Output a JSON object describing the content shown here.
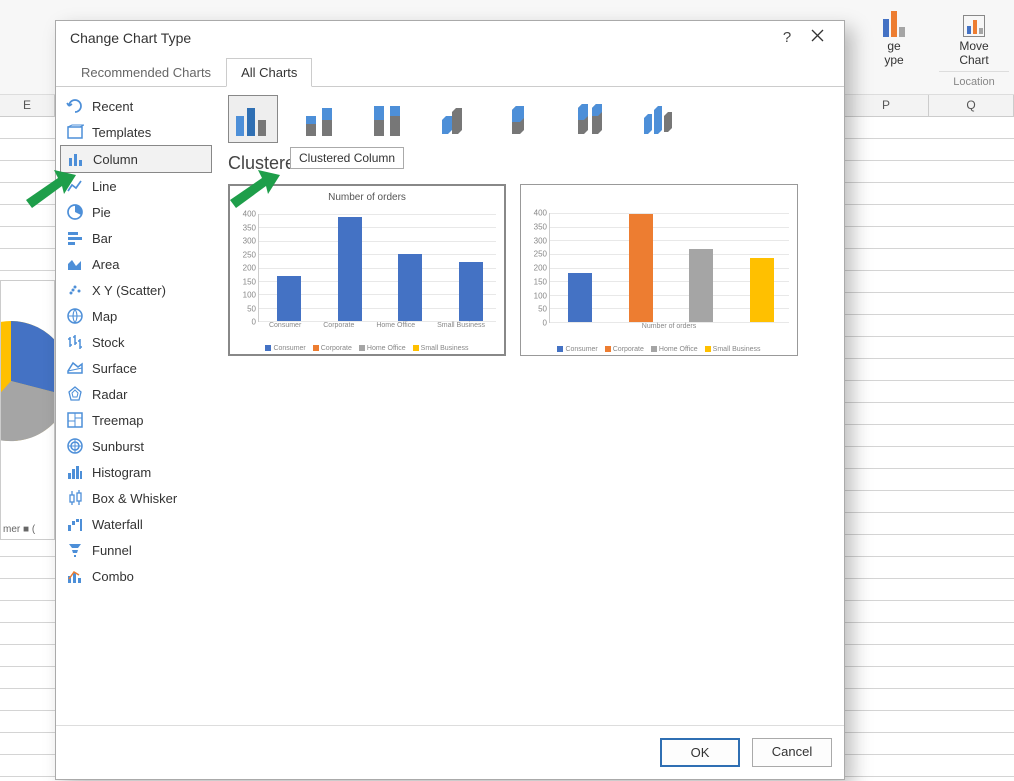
{
  "ribbon": {
    "change_type_btn_l1": "ge",
    "change_type_btn_l2": "ype",
    "move_chart_btn_l1": "Move",
    "move_chart_btn_l2": "Chart",
    "section_location": "Location"
  },
  "bg_columns": {
    "E": "E",
    "P": "P",
    "Q": "Q"
  },
  "bg_legend_frag": "mer   ■ (",
  "dialog": {
    "title": "Change Chart Type",
    "help": "?"
  },
  "tabs": {
    "recommended": "Recommended Charts",
    "all": "All Charts"
  },
  "categories": [
    {
      "label": "Recent",
      "icon": "recent"
    },
    {
      "label": "Templates",
      "icon": "templates"
    },
    {
      "label": "Column",
      "icon": "column",
      "selected": true
    },
    {
      "label": "Line",
      "icon": "line"
    },
    {
      "label": "Pie",
      "icon": "pie"
    },
    {
      "label": "Bar",
      "icon": "bar"
    },
    {
      "label": "Area",
      "icon": "area"
    },
    {
      "label": "X Y (Scatter)",
      "icon": "scatter"
    },
    {
      "label": "Map",
      "icon": "map"
    },
    {
      "label": "Stock",
      "icon": "stock"
    },
    {
      "label": "Surface",
      "icon": "surface"
    },
    {
      "label": "Radar",
      "icon": "radar"
    },
    {
      "label": "Treemap",
      "icon": "treemap"
    },
    {
      "label": "Sunburst",
      "icon": "sunburst"
    },
    {
      "label": "Histogram",
      "icon": "histogram"
    },
    {
      "label": "Box & Whisker",
      "icon": "box"
    },
    {
      "label": "Waterfall",
      "icon": "waterfall"
    },
    {
      "label": "Funnel",
      "icon": "funnel"
    },
    {
      "label": "Combo",
      "icon": "combo"
    }
  ],
  "subtype_tooltip": "Clustered Column",
  "subtype_heading": "Clustered Column",
  "buttons": {
    "ok": "OK",
    "cancel": "Cancel"
  },
  "chart_data": [
    {
      "type": "bar",
      "title": "Number of orders",
      "categories": [
        "Consumer",
        "Corporate",
        "Home Office",
        "Small Business"
      ],
      "values": [
        160,
        370,
        240,
        210
      ],
      "ylim": [
        0,
        400
      ],
      "yticks": [
        0,
        50,
        100,
        150,
        200,
        250,
        300,
        350,
        400
      ],
      "series_color_scheme": "single",
      "series": [
        {
          "name": "Number of orders",
          "color": "#4472C4"
        }
      ],
      "legend_items": [
        "Consumer",
        "Corporate",
        "Home Office",
        "Small Business"
      ],
      "legend_colors": [
        "#4472C4",
        "#ED7D31",
        "#A5A5A5",
        "#FFC000"
      ],
      "xlabels_shown": true
    },
    {
      "type": "bar",
      "title": "",
      "categories": [
        "Consumer",
        "Corporate",
        "Home Office",
        "Small Business"
      ],
      "values": [
        175,
        385,
        260,
        230
      ],
      "ylim": [
        0,
        400
      ],
      "yticks": [
        0,
        50,
        100,
        150,
        200,
        250,
        300,
        350,
        400
      ],
      "series_color_scheme": "varied",
      "legend_items": [
        "Consumer",
        "Corporate",
        "Home Office",
        "Small Business"
      ],
      "legend_colors": [
        "#4472C4",
        "#ED7D31",
        "#A5A5A5",
        "#FFC000"
      ],
      "axis_title": "Number of orders",
      "xlabels_shown": false
    }
  ]
}
